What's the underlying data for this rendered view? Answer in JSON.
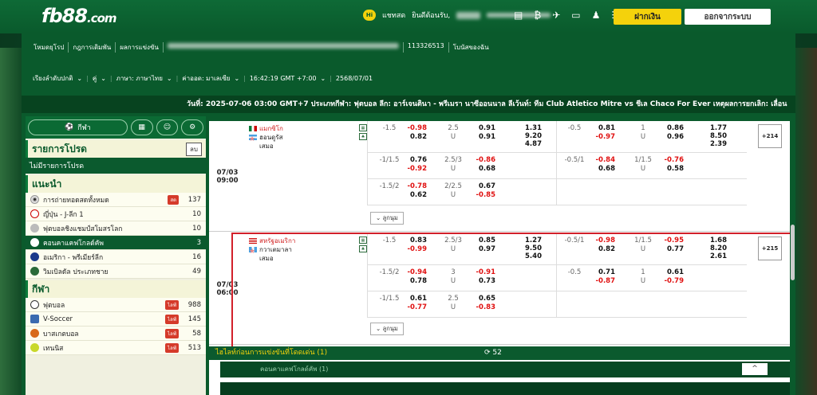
{
  "header": {
    "logo_main": "fb88",
    "logo_suffix": ".com",
    "hi": "Hi",
    "chat": "แชทสด",
    "welcome": "ยินดีต้อนรับ,",
    "deposit": "ฝากเงิน",
    "logout": "ออกจากระบบ"
  },
  "nav1": [
    "โหมดยุโรป",
    "กฎการเดิมพัน",
    "ผลการแข่งขัน"
  ],
  "account_id": "113326513",
  "bonus": "โบนัสของฉัน",
  "nav2": {
    "view": "เรียงลำดับปกติ",
    "unit": "คู่",
    "lang": "ภาษา: ภาษาไทย",
    "odds": "ค่าออด: มาเลเซีย",
    "time": "16:42:19 GMT +7:00",
    "date": "2568/07/01"
  },
  "ticker": "วันที่: 2025-07-06 03:00 GMT+7 ประเภทกีฬา: ฟุตบอล ลีก: อาร์เจนตินา - พรีเมรา นาซีออนนาล ลีเว้นท์: ทีม Club Atletico Mitre vs ชีเล Chaco For Ever เหตุผลการยกเลิก: เลื่อน",
  "sidebar": {
    "sport_pill": "กีฬา",
    "favorites_title": "รายการโปรด",
    "favorites_btn": "ลบ",
    "no_favorites": "ไม่มีรายการโปรด",
    "recommended_title": "แนะนำ",
    "recommended": [
      {
        "label": "การถ่ายทอดสดทั้งหมด",
        "count": "137",
        "live": "สด"
      },
      {
        "label": "ญี่ปุ่น - J-ลีก 1",
        "count": "10"
      },
      {
        "label": "ฟุตบอลชิงแชมป์สโมสรโลก",
        "count": "10"
      },
      {
        "label": "คอนคาแคฟโกลด์คัพ",
        "count": "3"
      },
      {
        "label": "อเมริกา - พรีเมียร์ลีก",
        "count": "16"
      },
      {
        "label": "วิมเบิลดัล ประเภทชาย",
        "count": "49"
      }
    ],
    "sports_title": "กีฬา",
    "sports": [
      {
        "label": "ฟุตบอล",
        "count": "988",
        "live": "ไลฟ์"
      },
      {
        "label": "V-Soccer",
        "count": "145",
        "live": "ไลฟ์"
      },
      {
        "label": "บาสเกตบอล",
        "count": "58",
        "live": "ไลฟ์"
      },
      {
        "label": "เทนนิส",
        "count": "513",
        "live": "ไลฟ์"
      }
    ]
  },
  "matches": [
    {
      "date": "07/03",
      "time": "09:00",
      "home": "แมกซิโก",
      "away": "ฮอนดูรัส",
      "draw": "เสมอ",
      "more": "ลูกนุม",
      "plus": "+214",
      "lines": [
        {
          "h1": "-1.5",
          "o1a": "-0.98",
          "o1b": "0.82",
          "t1": "2.5",
          "t1u": "U",
          "o2a": "0.91",
          "o2b": "0.91",
          "x1": "1.31",
          "x2": "9.20",
          "x3": "4.87",
          "h2": "-0.5",
          "o3a": "0.81",
          "o3b": "-0.97",
          "t2": "1",
          "t2u": "U",
          "o4a": "0.86",
          "o4b": "0.96",
          "y1": "1.77",
          "y2": "8.50",
          "y3": "2.39"
        },
        {
          "h1": "-1/1.5",
          "o1a": "0.76",
          "o1b": "-0.92",
          "t1": "2.5/3",
          "t1u": "U",
          "o2a": "-0.86",
          "o2b": "0.68",
          "h2": "-0.5/1",
          "o3a": "-0.84",
          "o3b": "0.68",
          "t2": "1/1.5",
          "t2u": "U",
          "o4a": "-0.76",
          "o4b": "0.58"
        },
        {
          "h1": "-1.5/2",
          "o1a": "-0.78",
          "o1b": "0.62",
          "t1": "2/2.5",
          "t1u": "U",
          "o2a": "0.67",
          "o2b": "-0.85"
        }
      ]
    },
    {
      "date": "07/03",
      "time": "06:00",
      "home": "สหรัฐอเมริกา",
      "away": "กวาเตมาลา",
      "draw": "เสมอ",
      "more": "ลูกนุม",
      "plus": "+215",
      "lines": [
        {
          "h1": "-1.5",
          "o1a": "0.83",
          "o1b": "-0.99",
          "t1": "2.5/3",
          "t1u": "U",
          "o2a": "0.85",
          "o2b": "0.97",
          "x1": "1.27",
          "x2": "9.50",
          "x3": "5.40",
          "h2": "-0.5/1",
          "o3a": "-0.98",
          "o3b": "0.82",
          "t2": "1/1.5",
          "t2u": "U",
          "o4a": "-0.95",
          "o4b": "0.77",
          "y1": "1.68",
          "y2": "8.20",
          "y3": "2.61"
        },
        {
          "h1": "-1.5/2",
          "o1a": "-0.94",
          "o1b": "0.78",
          "t1": "3",
          "t1u": "U",
          "o2a": "-0.91",
          "o2b": "0.73",
          "h2": "-0.5",
          "o3a": "0.71",
          "o3b": "-0.87",
          "t2": "1",
          "t2u": "U",
          "o4a": "0.61",
          "o4b": "-0.79"
        },
        {
          "h1": "-1/1.5",
          "o1a": "0.61",
          "o1b": "-0.77",
          "t1": "2.5",
          "t1u": "U",
          "o2a": "0.65",
          "o2b": "-0.83"
        }
      ]
    }
  ],
  "bottom": {
    "highlight": "ไฮไลท์ก่อนการแข่งขันที่โดดเด่น (1)",
    "refresh": "52",
    "league": "คอนคาแคฟโกลด์คัพ (1)",
    "up": "^"
  },
  "colors": {
    "brand": "#0a5a2c",
    "accent": "#f4d20c",
    "negative": "#e01010",
    "select": "#d2202a"
  }
}
